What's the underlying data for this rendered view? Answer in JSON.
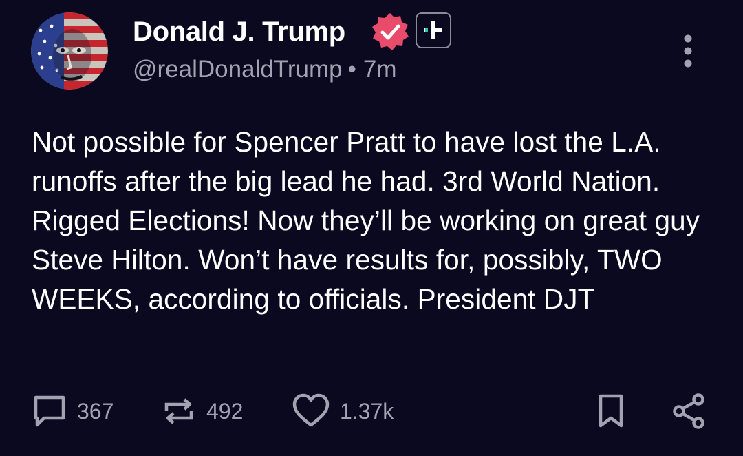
{
  "author": {
    "display_name": "Donald J. Trump",
    "handle": "@realDonaldTrump",
    "separator": "•",
    "time_ago": "7m"
  },
  "post": {
    "text": "Not possible for Spencer Pratt to have lost the L.A. runoffs after the big lead he had. 3rd World Nation. Rigged Elections! Now they’ll be working on great guy Steve Hilton. Won’t have results for, possibly, TWO WEEKS, according to officials. President DJT"
  },
  "actions": {
    "replies": "367",
    "retruths": "492",
    "likes": "1.37k"
  },
  "colors": {
    "background": "#0b0920",
    "text": "#ffffff",
    "muted": "#a3a2b0",
    "verified_badge": "#e84c6a"
  },
  "icons": {
    "verified": "verified-badge-icon",
    "follow": "follow-plus-icon",
    "more": "more-vertical-icon",
    "reply": "comment-icon",
    "retruth": "repost-icon",
    "like": "heart-icon",
    "bookmark": "bookmark-icon",
    "share": "share-icon"
  }
}
